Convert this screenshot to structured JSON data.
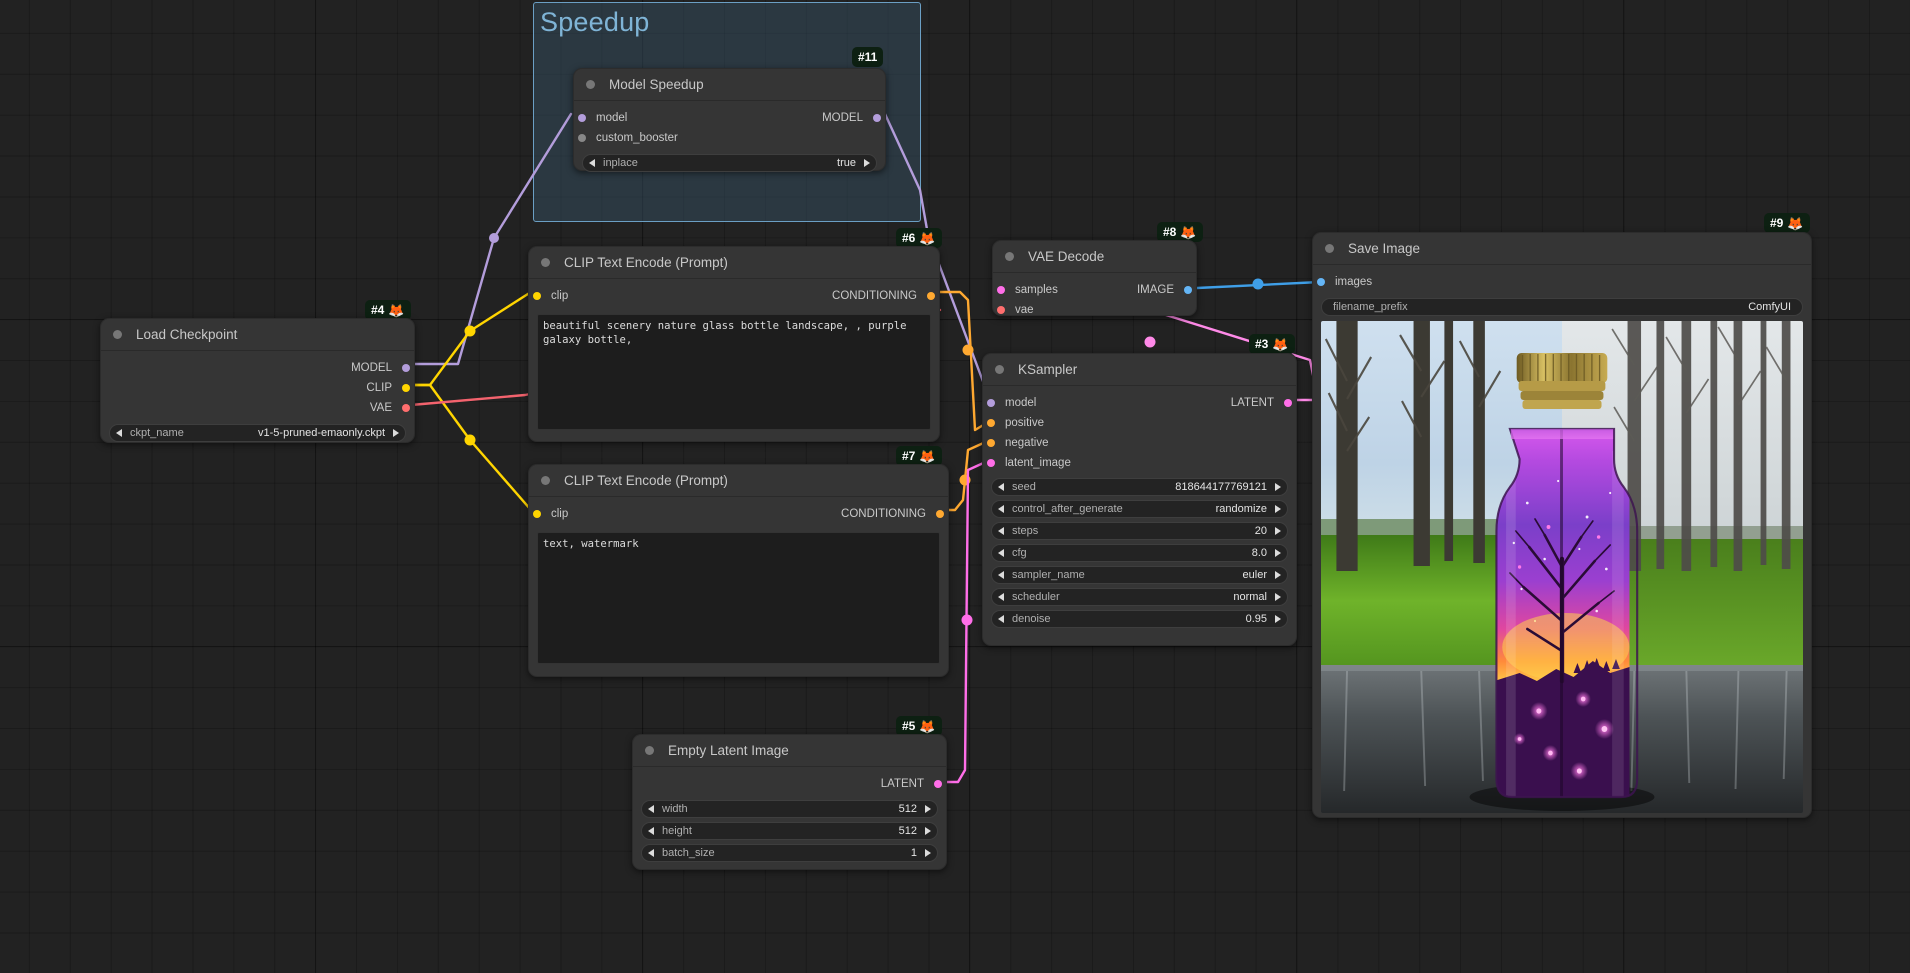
{
  "app": {
    "name": "ComfyUI",
    "canvas_background": "#222222",
    "grid_color": "#1a1a1a"
  },
  "group": {
    "title": "Speedup",
    "color": "#3a586e",
    "border_color": "#6b9fc4"
  },
  "port_colors": {
    "MODEL": "#b39ddb",
    "CLIP": "#ffd500",
    "VAE": "#ff6e6e",
    "CONDITIONING": "#ffa931",
    "LATENT": "#ff6ee8",
    "IMAGE": "#64b5f6",
    "generic": "#888888"
  },
  "nodes": {
    "model_speedup": {
      "id": "#11",
      "emoji": "🦊",
      "title": "Model Speedup",
      "inputs": [
        {
          "name": "model",
          "type": "MODEL"
        },
        {
          "name": "custom_booster",
          "type": "generic"
        }
      ],
      "outputs": [
        {
          "name": "MODEL",
          "type": "MODEL"
        }
      ],
      "widgets": [
        {
          "name": "inplace",
          "value": "true"
        }
      ]
    },
    "load_checkpoint": {
      "id": "#4",
      "emoji": "🦊",
      "title": "Load Checkpoint",
      "inputs": [],
      "outputs": [
        {
          "name": "MODEL",
          "type": "MODEL"
        },
        {
          "name": "CLIP",
          "type": "CLIP"
        },
        {
          "name": "VAE",
          "type": "VAE"
        }
      ],
      "widgets": [
        {
          "name": "ckpt_name",
          "value": "v1-5-pruned-emaonly.ckpt"
        }
      ]
    },
    "clip_positive": {
      "id": "#6",
      "emoji": "🦊",
      "title": "CLIP Text Encode (Prompt)",
      "inputs": [
        {
          "name": "clip",
          "type": "CLIP"
        }
      ],
      "outputs": [
        {
          "name": "CONDITIONING",
          "type": "CONDITIONING"
        }
      ],
      "text": "beautiful scenery nature glass bottle landscape, , purple galaxy bottle,"
    },
    "clip_negative": {
      "id": "#7",
      "emoji": "🦊",
      "title": "CLIP Text Encode (Prompt)",
      "inputs": [
        {
          "name": "clip",
          "type": "CLIP"
        }
      ],
      "outputs": [
        {
          "name": "CONDITIONING",
          "type": "CONDITIONING"
        }
      ],
      "text": "text, watermark"
    },
    "empty_latent": {
      "id": "#5",
      "emoji": "🦊",
      "title": "Empty Latent Image",
      "inputs": [],
      "outputs": [
        {
          "name": "LATENT",
          "type": "LATENT"
        }
      ],
      "widgets": [
        {
          "name": "width",
          "value": "512"
        },
        {
          "name": "height",
          "value": "512"
        },
        {
          "name": "batch_size",
          "value": "1"
        }
      ]
    },
    "ksampler": {
      "id": "#3",
      "emoji": "🦊",
      "title": "KSampler",
      "inputs": [
        {
          "name": "model",
          "type": "MODEL"
        },
        {
          "name": "positive",
          "type": "CONDITIONING"
        },
        {
          "name": "negative",
          "type": "CONDITIONING"
        },
        {
          "name": "latent_image",
          "type": "LATENT"
        }
      ],
      "outputs": [
        {
          "name": "LATENT",
          "type": "LATENT"
        }
      ],
      "widgets": [
        {
          "name": "seed",
          "value": "818644177769121"
        },
        {
          "name": "control_after_generate",
          "value": "randomize"
        },
        {
          "name": "steps",
          "value": "20"
        },
        {
          "name": "cfg",
          "value": "8.0"
        },
        {
          "name": "sampler_name",
          "value": "euler"
        },
        {
          "name": "scheduler",
          "value": "normal"
        },
        {
          "name": "denoise",
          "value": "0.95"
        }
      ]
    },
    "vae_decode": {
      "id": "#8",
      "emoji": "🦊",
      "title": "VAE Decode",
      "inputs": [
        {
          "name": "samples",
          "type": "LATENT"
        },
        {
          "name": "vae",
          "type": "VAE"
        }
      ],
      "outputs": [
        {
          "name": "IMAGE",
          "type": "IMAGE"
        }
      ],
      "widgets": []
    },
    "save_image": {
      "id": "#9",
      "emoji": "🦊",
      "title": "Save Image",
      "inputs": [
        {
          "name": "images",
          "type": "IMAGE"
        }
      ],
      "outputs": [],
      "widgets": [
        {
          "name": "filename_prefix",
          "value": "ComfyUI"
        }
      ],
      "preview_alt": "galaxy glass bottle in forest"
    }
  }
}
